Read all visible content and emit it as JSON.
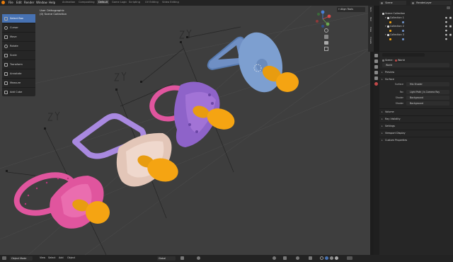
{
  "menubar": {
    "items": [
      "File",
      "Edit",
      "Render",
      "Window",
      "Help"
    ],
    "workspaces": [
      "Animation",
      "Compositing",
      "Default",
      "Game Logic",
      "Scripting",
      "UV Editing",
      "Video Editing"
    ],
    "active_workspace": "Default",
    "scene": "Scene",
    "view_layer": "RenderLayer"
  },
  "viewport": {
    "view_name": "User Orthographic",
    "collection_name": "(0) Scene Collection",
    "align_tools": "Align Tools",
    "empty_label": "ZY",
    "tools": [
      {
        "label": "Select Box",
        "active": true
      },
      {
        "label": "Cursor",
        "active": false
      },
      {
        "label": "Move",
        "active": false
      },
      {
        "label": "Rotate",
        "active": false
      },
      {
        "label": "Scale",
        "active": false
      },
      {
        "label": "Transform",
        "active": false
      },
      {
        "label": "Annotate",
        "active": false
      },
      {
        "label": "Measure",
        "active": false
      },
      {
        "label": "Add Cube",
        "active": false
      }
    ],
    "gizmo_axes": [
      "X",
      "Y",
      "Z"
    ]
  },
  "side_tabs": [
    "Item",
    "Tool",
    "View",
    "Create"
  ],
  "outliner": {
    "root": "Scene Collection",
    "collections": [
      "Collection 1",
      "Collection 2",
      "Collection 3"
    ]
  },
  "properties": {
    "scene_label": "Scene",
    "world_label": "World",
    "world_field": "World",
    "sections": [
      "Preview",
      "Surface"
    ],
    "surface_label": "Surface",
    "surface_value": "Mix Shader",
    "fac_label": "Fac",
    "fac_value": "Light Path | Is Camera Ray",
    "shader1_label": "Shader",
    "shader1_value": "Background",
    "shader2_label": "Shader",
    "shader2_value": "Background",
    "collapsed": [
      "Volume",
      "Ray Visibility",
      "Settings",
      "Viewport Display",
      "Custom Properties"
    ]
  },
  "statusbar": {
    "mode": "Object Mode",
    "menus": [
      "View",
      "Select",
      "Add",
      "Object"
    ],
    "pivot": "Global"
  },
  "colors": {
    "accent": "#4772b3",
    "pink": "#e0559e",
    "lavender": "#a989e0",
    "beige": "#e3c6b8",
    "purple": "#8e63c9",
    "blue": "#7d9fd0",
    "orange": "#f5a412"
  }
}
